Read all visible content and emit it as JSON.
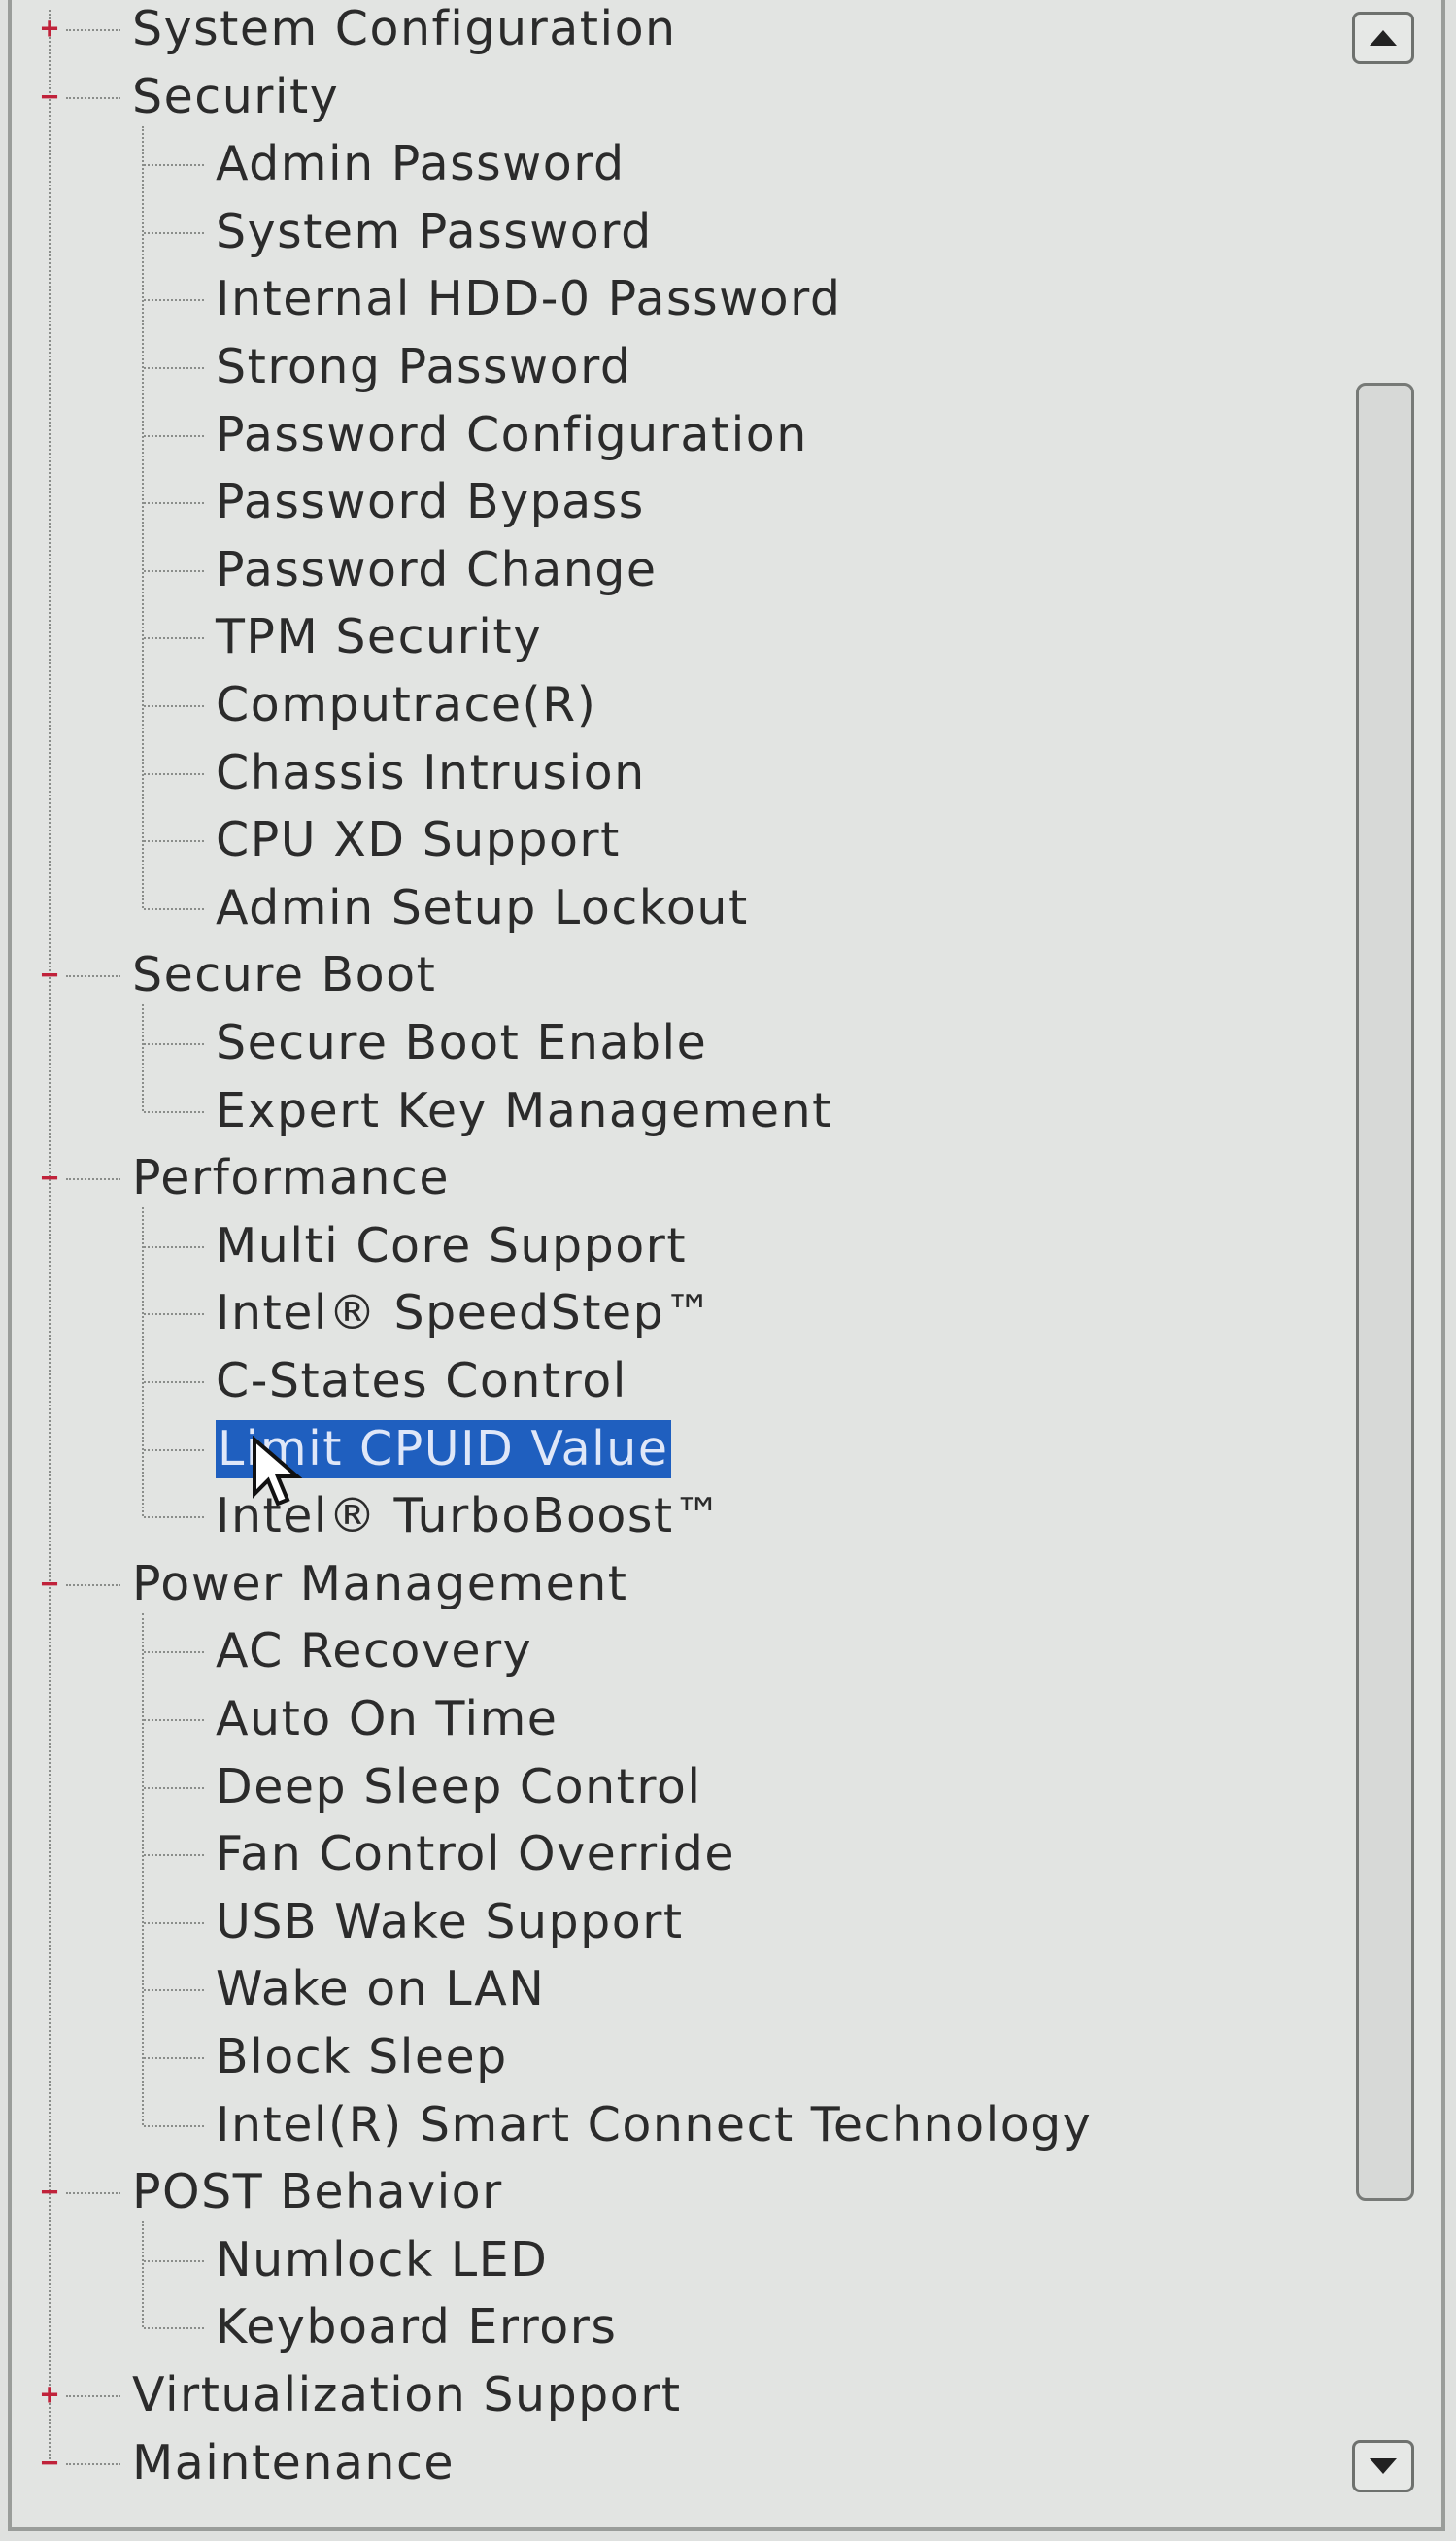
{
  "tree": [
    {
      "label": "System Configuration",
      "level": 0,
      "toggle": "+"
    },
    {
      "label": "Security",
      "level": 0,
      "toggle": "−"
    },
    {
      "label": "Admin Password",
      "level": 1
    },
    {
      "label": "System Password",
      "level": 1
    },
    {
      "label": "Internal HDD-0 Password",
      "level": 1
    },
    {
      "label": "Strong Password",
      "level": 1
    },
    {
      "label": "Password Configuration",
      "level": 1
    },
    {
      "label": "Password Bypass",
      "level": 1
    },
    {
      "label": "Password Change",
      "level": 1
    },
    {
      "label": "TPM Security",
      "level": 1
    },
    {
      "label": "Computrace(R)",
      "level": 1
    },
    {
      "label": "Chassis Intrusion",
      "level": 1
    },
    {
      "label": "CPU XD Support",
      "level": 1
    },
    {
      "label": "Admin Setup Lockout",
      "level": 1
    },
    {
      "label": "Secure Boot",
      "level": 0,
      "toggle": "−"
    },
    {
      "label": "Secure Boot Enable",
      "level": 1
    },
    {
      "label": "Expert Key Management",
      "level": 1
    },
    {
      "label": "Performance",
      "level": 0,
      "toggle": "−"
    },
    {
      "label": "Multi Core Support",
      "level": 1
    },
    {
      "label": "Intel® SpeedStep™",
      "level": 1
    },
    {
      "label": "C-States Control",
      "level": 1
    },
    {
      "label": "Limit CPUID Value",
      "level": 1,
      "selected": true
    },
    {
      "label": "Intel® TurboBoost™",
      "level": 1
    },
    {
      "label": "Power Management",
      "level": 0,
      "toggle": "−"
    },
    {
      "label": "AC Recovery",
      "level": 1
    },
    {
      "label": "Auto On Time",
      "level": 1
    },
    {
      "label": "Deep Sleep Control",
      "level": 1
    },
    {
      "label": "Fan Control Override",
      "level": 1
    },
    {
      "label": "USB Wake Support",
      "level": 1
    },
    {
      "label": "Wake on LAN",
      "level": 1
    },
    {
      "label": "Block Sleep",
      "level": 1
    },
    {
      "label": "Intel(R) Smart Connect Technology",
      "level": 1
    },
    {
      "label": "POST Behavior",
      "level": 0,
      "toggle": "−"
    },
    {
      "label": "Numlock LED",
      "level": 1
    },
    {
      "label": "Keyboard Errors",
      "level": 1
    },
    {
      "label": "Virtualization Support",
      "level": 0,
      "toggle": "+"
    },
    {
      "label": "Maintenance",
      "level": 0,
      "toggle": "−"
    }
  ],
  "scrollbar": {
    "up_icon": "arrow-up-icon",
    "down_icon": "arrow-down-icon"
  },
  "colors": {
    "selection": "#1f5fbf",
    "toggle": "#c0223a",
    "background": "#e2e4e2"
  }
}
